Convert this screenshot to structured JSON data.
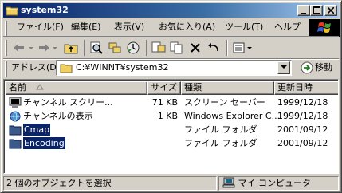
{
  "window": {
    "title": "system32"
  },
  "menu": {
    "items": [
      "ファイル(F)",
      "編集(E)",
      "表示(V)",
      "お気に入り(A)",
      "ツール(T)",
      "ヘルプ"
    ]
  },
  "address": {
    "label": "アドレス(D)",
    "path": "C:¥WINNT¥system32",
    "go_label": "移動"
  },
  "columns": [
    "名前",
    "サイズ",
    "種類",
    "更新日時"
  ],
  "files": [
    {
      "name": "チャンネル スクリー...",
      "size": "71 KB",
      "type": "スクリーン セーバー",
      "modified": "1999/12/18",
      "icon": "screensaver-icon",
      "selected": false
    },
    {
      "name": "チャンネルの表示",
      "size": "1 KB",
      "type": "Windows Explorer C...",
      "modified": "1999/12/18",
      "icon": "explorer-command-icon",
      "selected": false
    },
    {
      "name": "Cmap",
      "size": "",
      "type": "ファイル フォルダ",
      "modified": "2001/09/12",
      "icon": "folder-icon",
      "selected": true
    },
    {
      "name": "Encoding",
      "size": "",
      "type": "ファイル フォルダ",
      "modified": "2001/09/12",
      "icon": "folder-icon",
      "selected": true
    }
  ],
  "status": {
    "selection_text": "2 個のオブジェクトを選択",
    "location_text": "マイ コンピュータ"
  },
  "colors": {
    "titlebar_start": "#0a246a",
    "titlebar_end": "#a6caf0",
    "face": "#d4d0c8",
    "selection": "#0a246a"
  }
}
